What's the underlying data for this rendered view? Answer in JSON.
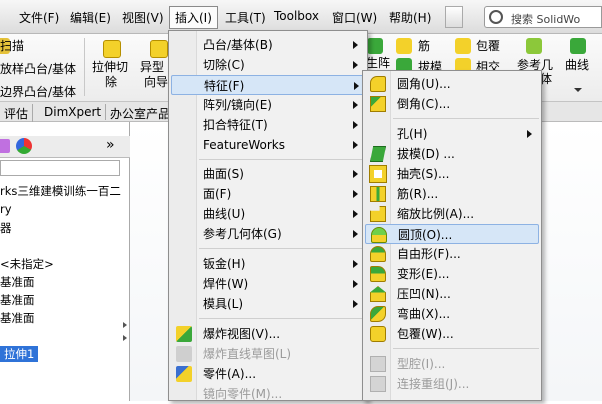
{
  "menubar": {
    "items": [
      "文件(F)",
      "编辑(E)",
      "视图(V)",
      "插入(I)",
      "工具(T)",
      "Toolbox",
      "窗口(W)",
      "帮助(H)"
    ],
    "search_text": "搜索 SolidWo"
  },
  "ribbon": {
    "left_items": [
      "扫描",
      "放样凸台/基体",
      "边界凸台/基体"
    ],
    "big_btn_1": [
      "拉伸切",
      "除"
    ],
    "big_btn_2": [
      "异型",
      "向导"
    ],
    "right_items": [
      "筋",
      "拔模",
      "包覆",
      "相交"
    ],
    "array_label": "生阵",
    "ref_label": [
      "参考几",
      "何体"
    ],
    "curve_label": "曲线"
  },
  "tabs": [
    "评估",
    "DimXpert",
    "办公室产品"
  ],
  "panel": {
    "rows": [
      "rks三维建模训练一百二",
      "ry",
      "器",
      "<未指定>",
      "基准面",
      "基准面",
      "基准面"
    ],
    "selected": "拉伸1",
    "expand": "»"
  },
  "insert_menu": {
    "items": [
      {
        "label": "凸台/基体(B)",
        "sub": true
      },
      {
        "label": "切除(C)",
        "sub": true
      },
      {
        "label": "特征(F)",
        "sub": true,
        "hl": true
      },
      {
        "label": "阵列/镜向(E)",
        "sub": true
      },
      {
        "label": "扣合特征(T)",
        "sub": true
      },
      {
        "label": "FeatureWorks",
        "sub": true
      },
      {
        "label": "曲面(S)",
        "sub": true
      },
      {
        "label": "面(F)",
        "sub": true
      },
      {
        "label": "曲线(U)",
        "sub": true
      },
      {
        "label": "参考几何体(G)",
        "sub": true
      },
      {
        "label": "钣金(H)",
        "sub": true
      },
      {
        "label": "焊件(W)",
        "sub": true
      },
      {
        "label": "模具(L)",
        "sub": true
      },
      {
        "label": "爆炸视图(V)..."
      },
      {
        "label": "爆炸直线草图(L)",
        "dis": true
      },
      {
        "label": "零件(A)..."
      },
      {
        "label": "镜向零件(M)...",
        "dis": true
      }
    ]
  },
  "feature_menu": {
    "items": [
      {
        "label": "圆角(U)...",
        "icon": "fillet-icon"
      },
      {
        "label": "倒角(C)...",
        "icon": "chamfer-icon"
      },
      {
        "label": "孔(H)",
        "sub": true
      },
      {
        "label": "拔模(D) ...",
        "icon": "draft-icon"
      },
      {
        "label": "抽壳(S)...",
        "icon": "shell-icon"
      },
      {
        "label": "筋(R)...",
        "icon": "rib-icon"
      },
      {
        "label": "缩放比例(A)...",
        "icon": "scale-icon"
      },
      {
        "label": "圆顶(O)...",
        "icon": "dome-icon",
        "hl": true
      },
      {
        "label": "自由形(F)...",
        "icon": "freeform-icon"
      },
      {
        "label": "变形(E)...",
        "icon": "deform-icon"
      },
      {
        "label": "压凹(N)...",
        "icon": "indent-icon"
      },
      {
        "label": "弯曲(X)...",
        "icon": "flex-icon"
      },
      {
        "label": "包覆(W)...",
        "icon": "wrap-icon"
      },
      {
        "label": "型腔(I)...",
        "icon": "cavity-icon",
        "dis": true
      },
      {
        "label": "连接重组(J)...",
        "icon": "join-icon",
        "dis": true
      }
    ]
  },
  "colors": {
    "highlight": "#d6e6f7",
    "selection": "#2f73d8",
    "icon_yellow": "#f3d12a",
    "icon_green": "#3aa83a"
  }
}
